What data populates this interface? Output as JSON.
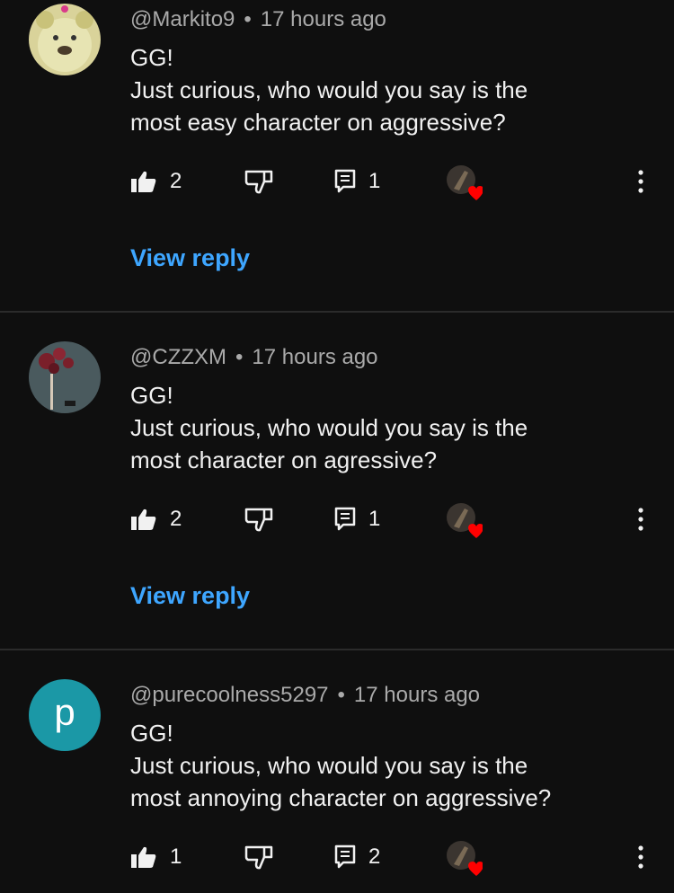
{
  "comments": [
    {
      "author": "@Markito9",
      "time": "17 hours ago",
      "separator": "•",
      "lines": [
        "GG!",
        "Just curious, who would you say is the",
        "most easy character on aggressive?"
      ],
      "likes": "2",
      "replies": "1",
      "view_reply": "View reply",
      "avatar_icon": "bear-avatar"
    },
    {
      "author": "@CZZXM",
      "time": "17 hours ago",
      "separator": "•",
      "lines": [
        "GG!",
        "Just curious, who would you say is the",
        "most character on agressive?"
      ],
      "likes": "2",
      "replies": "1",
      "view_reply": "View reply",
      "avatar_icon": "flowers-avatar"
    },
    {
      "author": "@purecoolness5297",
      "time": "17 hours ago",
      "separator": "•",
      "lines": [
        "GG!",
        "Just curious, who would you say is the",
        "most annoying character on aggressive?"
      ],
      "likes": "1",
      "replies": "2",
      "avatar_letter": "p",
      "avatar_color": "#1b98a6"
    }
  ],
  "colors": {
    "background": "#0f0f0f",
    "link": "#3ea6ff",
    "heart": "#ff0000"
  }
}
